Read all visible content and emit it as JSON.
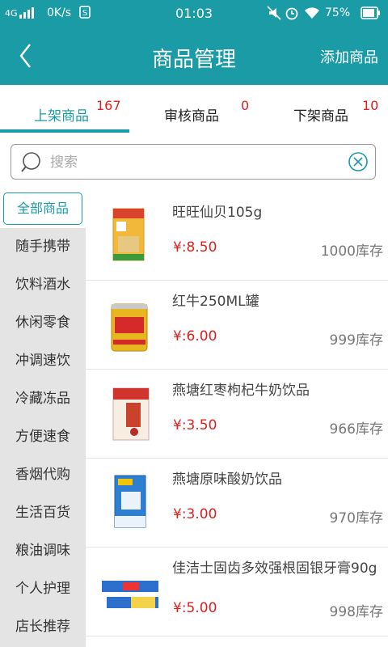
{
  "status_bar": {
    "network": "4G",
    "speed": "0K/s",
    "time": "01:03",
    "battery": "75%"
  },
  "header": {
    "title": "商品管理",
    "add_label": "添加商品"
  },
  "tabs": [
    {
      "label": "上架商品",
      "count": "167"
    },
    {
      "label": "审核商品",
      "count": "0"
    },
    {
      "label": "下架商品",
      "count": "10"
    }
  ],
  "search": {
    "placeholder": "搜索"
  },
  "categories": {
    "all": "全部商品",
    "items": [
      "随手携带",
      "饮料酒水",
      "休闲零食",
      "冲调速饮",
      "冷藏冻品",
      "方便速食",
      "香烟代购",
      "生活百货",
      "粮油调味",
      "个人护理",
      "店长推荐"
    ]
  },
  "products": [
    {
      "name": "旺旺仙贝105g",
      "price": "¥:8.50",
      "stock": "1000库存"
    },
    {
      "name": "红牛250ML罐",
      "price": "¥:6.00",
      "stock": "999库存"
    },
    {
      "name": "燕塘红枣枸杞牛奶饮品",
      "price": "¥:3.50",
      "stock": "966库存"
    },
    {
      "name": "燕塘原味酸奶饮品",
      "price": "¥:3.00",
      "stock": "970库存"
    },
    {
      "name": "佳洁士固齿多效强根固银牙膏90g",
      "price": "¥:5.00",
      "stock": "998库存"
    }
  ]
}
